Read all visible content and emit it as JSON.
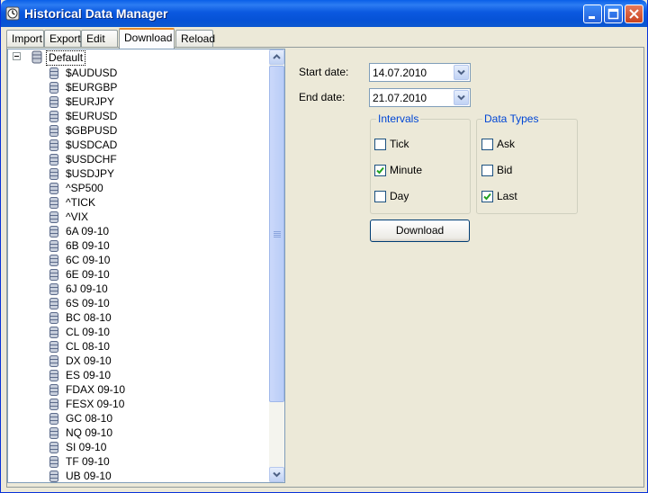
{
  "window": {
    "title": "Historical Data Manager"
  },
  "tabs": [
    {
      "label": "Import"
    },
    {
      "label": "Export"
    },
    {
      "label": "Edit"
    },
    {
      "label": "Download"
    },
    {
      "label": "Reload"
    }
  ],
  "active_tab": "Download",
  "tree": {
    "root": "Default",
    "items": [
      "$AUDUSD",
      "$EURGBP",
      "$EURJPY",
      "$EURUSD",
      "$GBPUSD",
      "$USDCAD",
      "$USDCHF",
      "$USDJPY",
      "^SP500",
      "^TICK",
      "^VIX",
      "6A 09-10",
      "6B 09-10",
      "6C 09-10",
      "6E 09-10",
      "6J 09-10",
      "6S 09-10",
      "BC 08-10",
      "CL 09-10",
      "CL 08-10",
      "DX 09-10",
      "ES 09-10",
      "FDAX 09-10",
      "FESX 09-10",
      "GC 08-10",
      "NQ 09-10",
      "SI 09-10",
      "TF 09-10",
      "UB 09-10"
    ]
  },
  "form": {
    "start_label": "Start date:",
    "start_value": "14.07.2010",
    "end_label": "End date:",
    "end_value": "21.07.2010"
  },
  "intervals": {
    "title": "Intervals",
    "options": [
      {
        "label": "Tick",
        "checked": false
      },
      {
        "label": "Minute",
        "checked": true
      },
      {
        "label": "Day",
        "checked": false
      }
    ]
  },
  "data_types": {
    "title": "Data Types",
    "options": [
      {
        "label": "Ask",
        "checked": false
      },
      {
        "label": "Bid",
        "checked": false
      },
      {
        "label": "Last",
        "checked": true
      }
    ]
  },
  "download_button": "Download",
  "colors": {
    "title_bar": "#0b59e0",
    "accent_tab": "#e68b2c",
    "group_title": "#0046d5"
  }
}
